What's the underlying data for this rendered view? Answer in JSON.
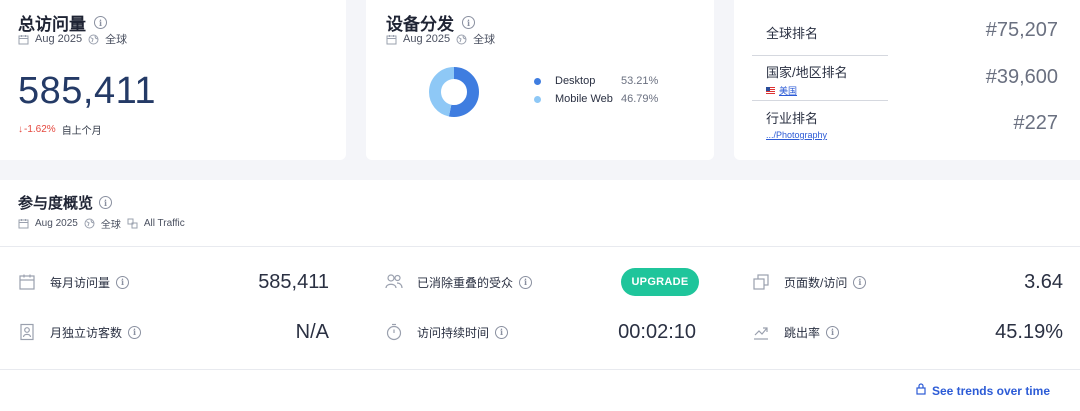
{
  "visits_card": {
    "title": "总访问量",
    "date": "Aug 2025",
    "region": "全球",
    "value": "585,411",
    "change": "-1.62%",
    "change_label": "自上个月"
  },
  "device_card": {
    "title": "设备分发",
    "date": "Aug 2025",
    "region": "全球",
    "chart_data": {
      "type": "pie",
      "categories": [
        "Desktop",
        "Mobile Web"
      ],
      "values": [
        53.21,
        46.79
      ],
      "colors": [
        "#3f7de0",
        "#8ec8f6"
      ]
    },
    "legend": [
      {
        "name": "Desktop",
        "pct": "53.21%",
        "color": "#3f7de0"
      },
      {
        "name": "Mobile Web",
        "pct": "46.79%",
        "color": "#8ec8f6"
      }
    ]
  },
  "rank_card": {
    "global": {
      "label": "全球排名",
      "value": "#75,207"
    },
    "country": {
      "label": "国家/地区排名",
      "sub": "美国",
      "value": "#39,600"
    },
    "industry": {
      "label": "行业排名",
      "sub": ".../Photography",
      "value": "#227"
    }
  },
  "engagement": {
    "title": "参与度概览",
    "date": "Aug 2025",
    "region": "全球",
    "traffic": "All Traffic",
    "metrics": {
      "monthly_visits": {
        "label": "每月访问量",
        "value": "585,411",
        "icon": "calendar-icon"
      },
      "unique_visitors": {
        "label": "月独立访客数",
        "value": "N/A",
        "icon": "person-badge-icon"
      },
      "deduplicated_audience": {
        "label": "已消除重叠的受众",
        "button": "UPGRADE",
        "icon": "people-icon"
      },
      "visit_duration": {
        "label": "访问持续时间",
        "value": "00:02:10",
        "icon": "stopwatch-icon"
      },
      "pages_per_visit": {
        "label": "页面数/访问",
        "value": "3.64",
        "icon": "pages-icon"
      },
      "bounce_rate": {
        "label": "跳出率",
        "value": "45.19%",
        "icon": "bounce-arrow-icon"
      }
    },
    "trends_link": "See trends over time"
  }
}
